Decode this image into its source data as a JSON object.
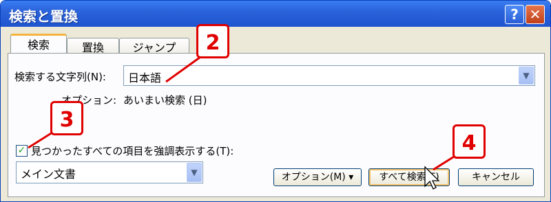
{
  "window": {
    "title": "検索と置換",
    "help_label": "?",
    "close_label": "✕"
  },
  "tabs": [
    {
      "label": "検索",
      "active": true
    },
    {
      "label": "置換",
      "active": false
    },
    {
      "label": "ジャンプ",
      "active": false
    }
  ],
  "search": {
    "label": "検索する文字列(N):",
    "value": "日本語"
  },
  "options": {
    "label": "オプション:",
    "value": "あいまい検索 (日)"
  },
  "highlight": {
    "label": "見つかったすべての項目を強調表示する(T):",
    "checked": true,
    "check_glyph": "✓"
  },
  "scope_select": {
    "value": "メイン文書"
  },
  "buttons": {
    "options": "オプション(M) ▾",
    "find_all": "すべて検索(F)",
    "cancel": "キャンセル"
  },
  "callouts": [
    "2",
    "3",
    "4"
  ],
  "icons": {
    "dropdown": "chevron-down-icon",
    "cursor": "arrow-cursor-icon"
  },
  "colors": {
    "callout": "#e00000",
    "titlebar": "#2a63db",
    "accent_tab": "#f3b33d"
  }
}
